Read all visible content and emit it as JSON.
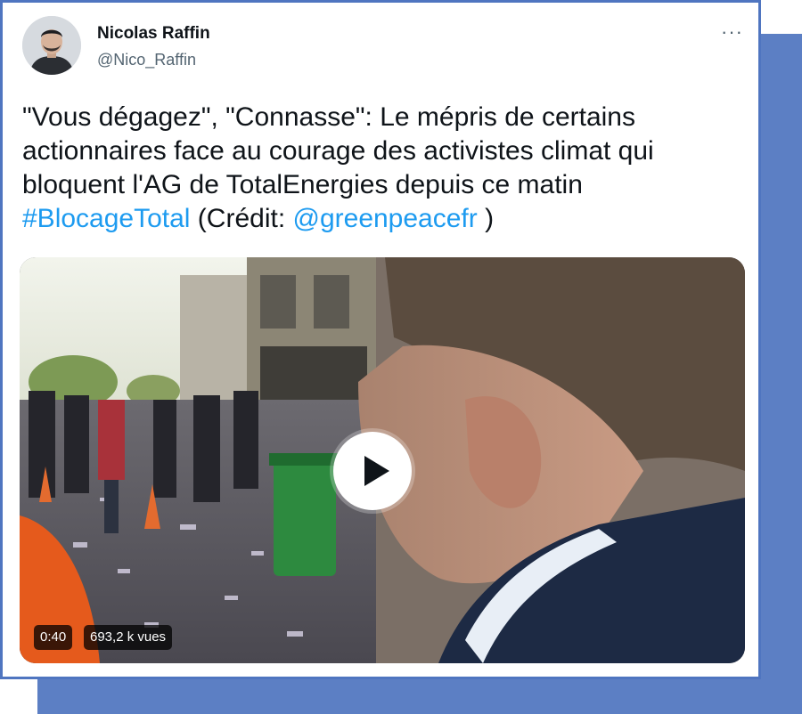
{
  "tweet": {
    "author": {
      "name": "Nicolas Raffin",
      "handle": "@Nico_Raffin"
    },
    "more_label": "···",
    "text": {
      "line1": "\"Vous dégagez\", \"Connasse\": Le mépris de certains",
      "line2": "actionnaires face au courage des activistes climat qui",
      "line3": "bloquent l'AG de TotalEnergies depuis ce matin",
      "hashtag": "#BlocageTotal",
      "credit_prefix": " (Crédit: ",
      "mention": "@greenpeacefr",
      "credit_suffix": " )"
    }
  },
  "video": {
    "duration": "0:40",
    "views": "693,2 k vues"
  },
  "colors": {
    "frame": "#4f75c0",
    "backdrop": "#5c7fc4",
    "link": "#1d9bf0",
    "text": "#0f1419",
    "secondary": "#536471"
  },
  "icons": [
    "more-options-icon",
    "play-icon"
  ]
}
